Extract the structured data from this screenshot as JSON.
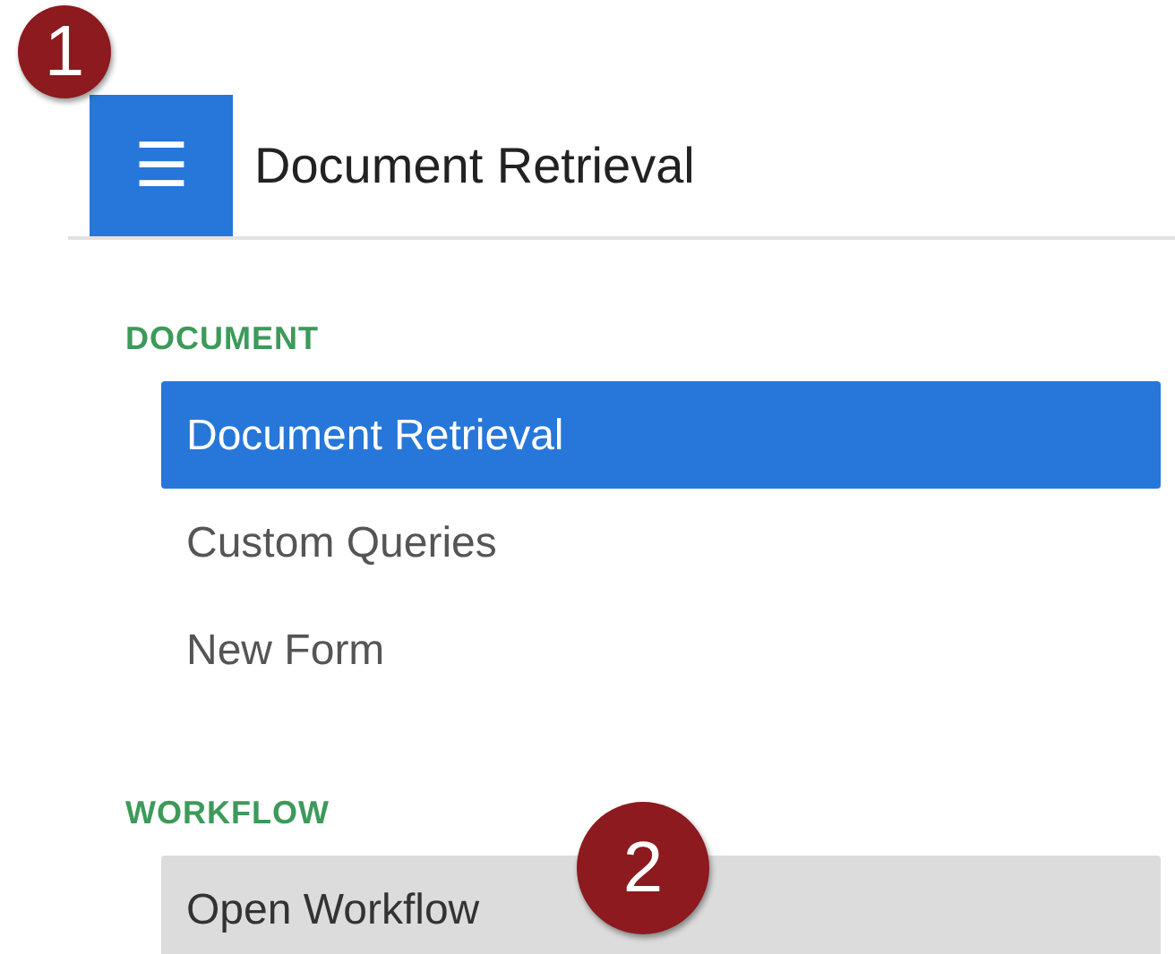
{
  "header": {
    "menu_icon": "☰",
    "title": "Document Retrieval"
  },
  "sections": [
    {
      "heading": "DOCUMENT",
      "items": [
        {
          "label": "Document Retrieval",
          "selected": true,
          "highlighted": false
        },
        {
          "label": "Custom Queries",
          "selected": false,
          "highlighted": false
        },
        {
          "label": "New Form",
          "selected": false,
          "highlighted": false
        }
      ]
    },
    {
      "heading": "WORKFLOW",
      "items": [
        {
          "label": "Open Workflow",
          "selected": false,
          "highlighted": true
        }
      ]
    }
  ],
  "callouts": [
    {
      "label": "1"
    },
    {
      "label": "2"
    }
  ]
}
